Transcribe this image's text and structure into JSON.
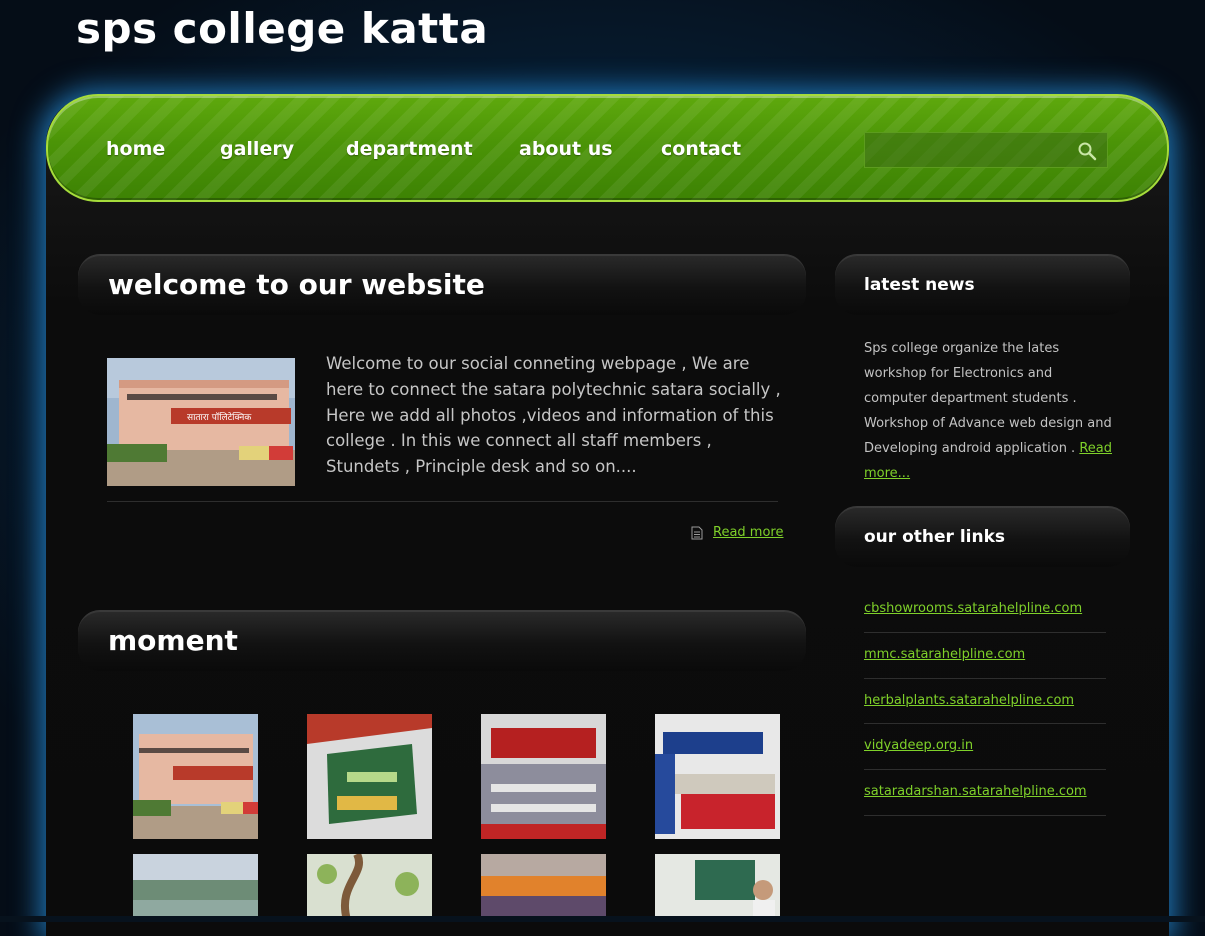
{
  "site": {
    "title": "sps college katta"
  },
  "nav": {
    "items": [
      "home",
      "gallery",
      "department",
      "about us",
      "contact"
    ],
    "search_placeholder": ""
  },
  "welcome": {
    "heading": "welcome to our website",
    "text": "Welcome to our social conneting webpage , We are here to connect the satara polytechnic satara socially , Here we add all photos ,videos and information of this college . In this we connect all staff members , Stundets , Principle desk and so on....",
    "read_more": "Read more"
  },
  "moment": {
    "heading": "moment"
  },
  "latest_news": {
    "heading": "latest news",
    "text": "Sps college organize the lates workshop for Electronics and computer department students . Workshop of Advance web design and Developing android application . ",
    "read_more": "Read more..."
  },
  "other_links": {
    "heading": "our other links",
    "links": [
      "cbshowrooms.satarahelpline.com",
      "mmc.satarahelpline.com",
      "herbalplants.satarahelpline.com",
      "vidyadeep.org.in",
      "sataradarshan.satarahelpline.com"
    ]
  },
  "colors": {
    "accent_green": "#7fd12a",
    "nav_green": "#4b9407",
    "glow_blue": "#2896e6"
  }
}
